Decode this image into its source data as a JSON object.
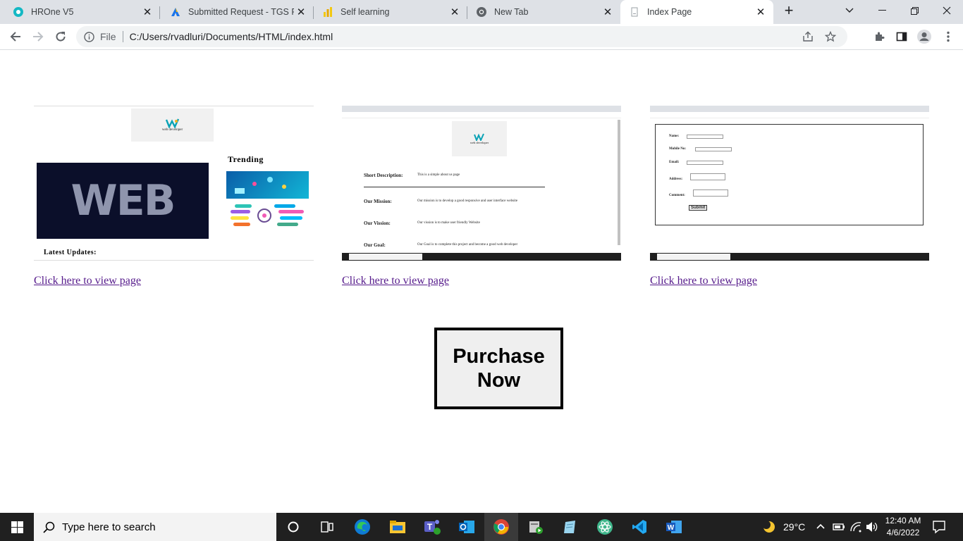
{
  "browser": {
    "tabs": [
      {
        "title": "HROne V5",
        "icon": "hrone-icon"
      },
      {
        "title": "Submitted Request - TGS Portal",
        "icon": "azure-devops-icon"
      },
      {
        "title": "Self learning",
        "icon": "powerbi-icon"
      },
      {
        "title": "New Tab",
        "icon": "chrome-icon"
      },
      {
        "title": "Index Page",
        "icon": "file-icon",
        "active": true
      }
    ],
    "new_tab": "+",
    "address": {
      "scheme_label": "File",
      "url": "C:/Users/rvadluri/Documents/HTML/index.html"
    }
  },
  "page": {
    "cards": [
      {
        "thumb": {
          "logo_text": "web developer",
          "trending": "Trending",
          "web_text": "WEB",
          "latest_updates": "Latest Updates:"
        },
        "link": "Click here to view page"
      },
      {
        "thumb": {
          "logo_text": "web developer",
          "rows": [
            {
              "label": "Short Description:",
              "text": "This is a simple about us page"
            },
            {
              "label": "Our Mission:",
              "text": "Our mission is to develop a good responsive and user interface website"
            },
            {
              "label": "Our Vission:",
              "text": "Our vission is to make user friendly Website"
            },
            {
              "label": "Our Goal:",
              "text": "Our Goal is to complete this project and become a good web developer"
            }
          ]
        },
        "link": "Click here to view page"
      },
      {
        "thumb": {
          "fields": [
            "Name:",
            "Mobile No:",
            "Email:",
            "Address:",
            "Comment:"
          ],
          "submit": "Submit"
        },
        "link": "Click here to view page"
      }
    ],
    "purchase_button": "Purchase Now"
  },
  "taskbar": {
    "search_placeholder": "Type here to search",
    "weather": "29°C",
    "time": "12:40 AM",
    "date": "4/6/2022"
  }
}
